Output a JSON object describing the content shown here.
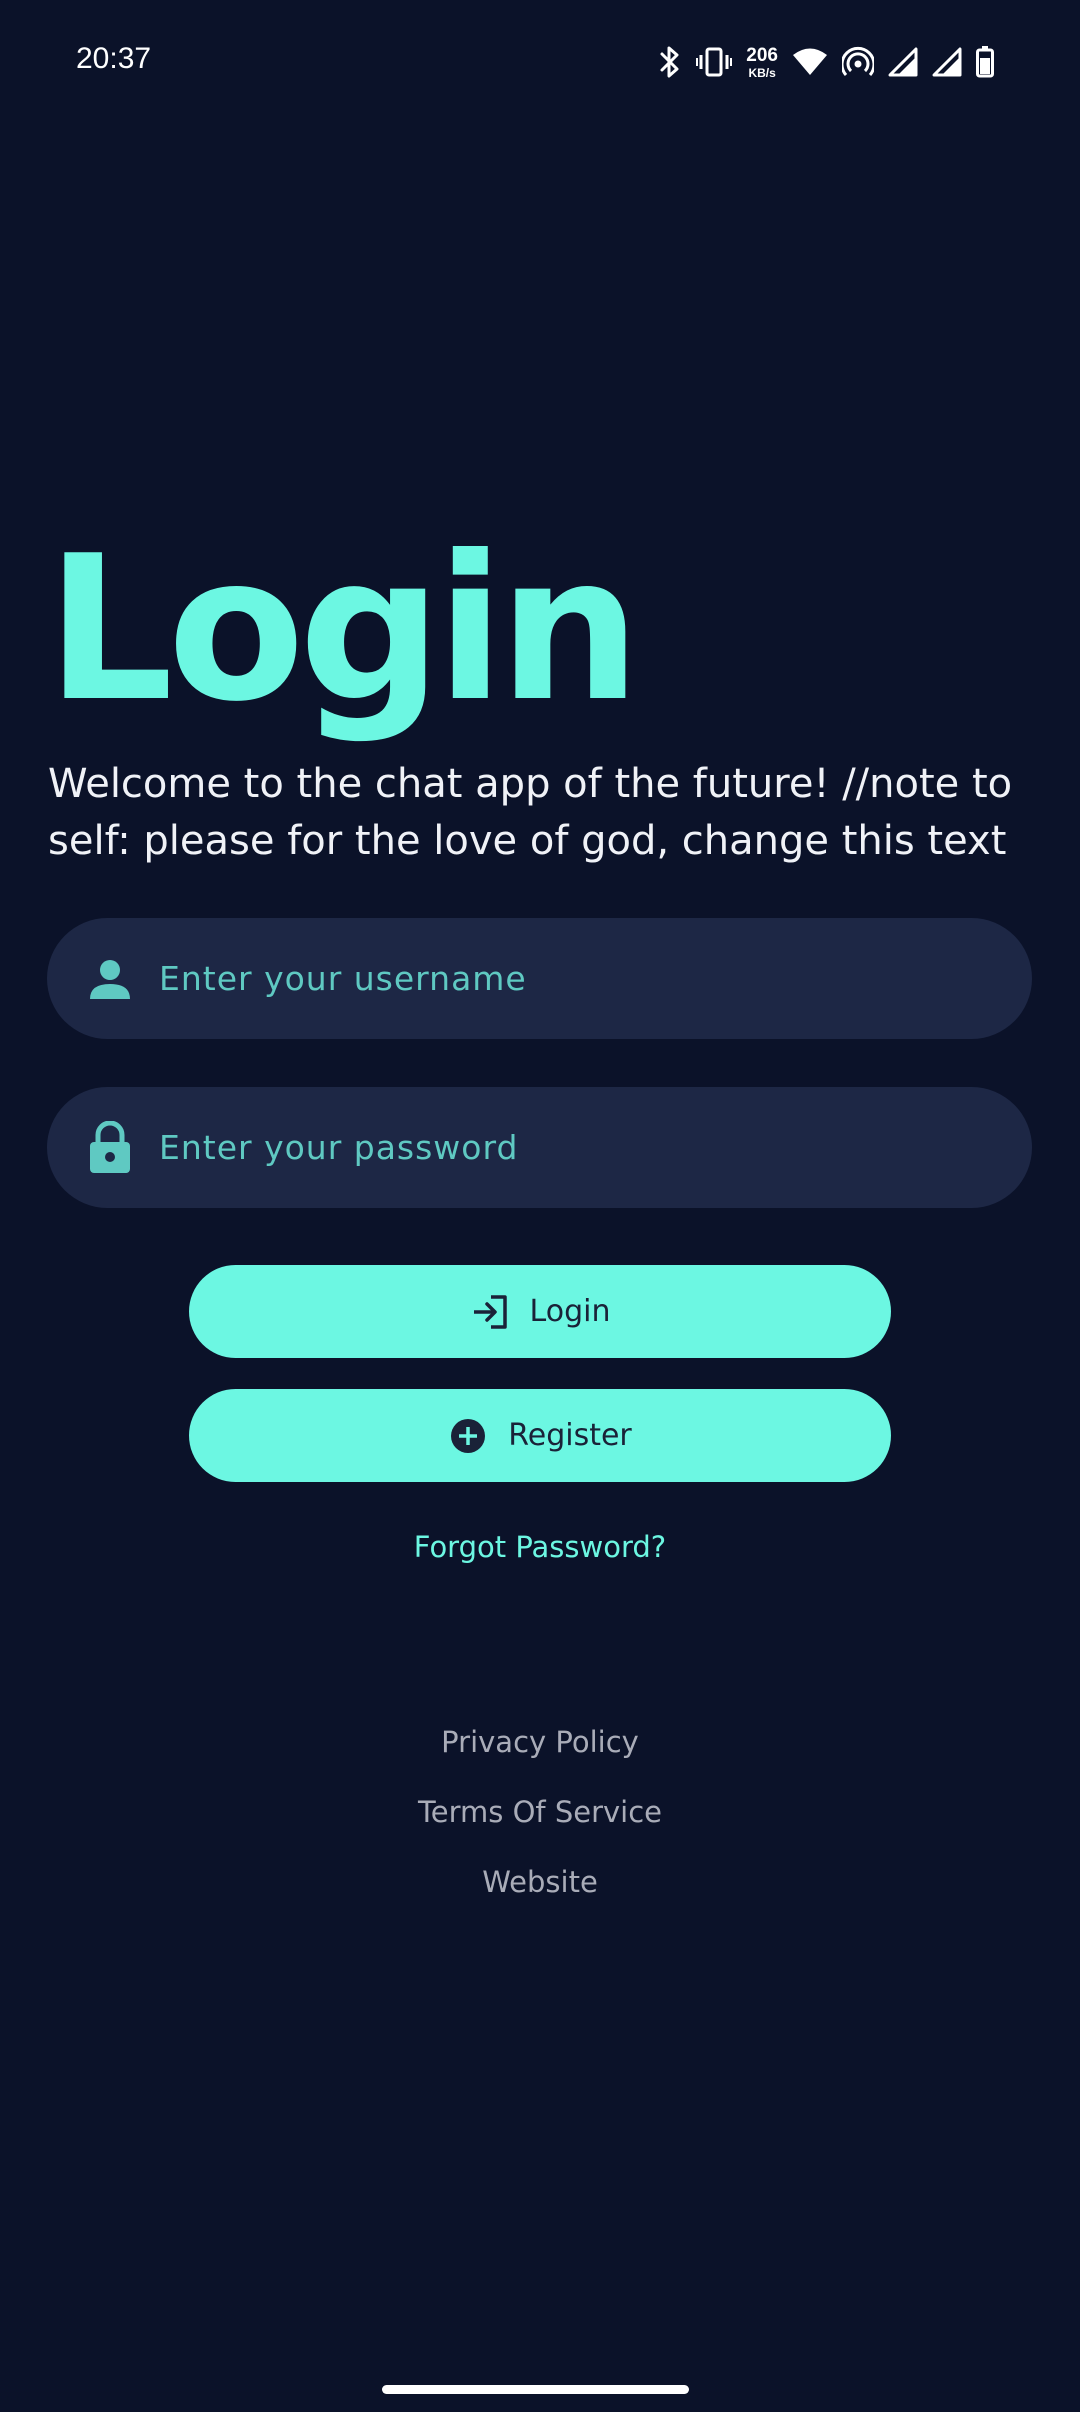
{
  "status_bar": {
    "time": "20:37",
    "net_speed_value": "206",
    "net_speed_unit": "KB/s",
    "icons": [
      "bluetooth-icon",
      "vibrate-icon",
      "wifi-icon",
      "hotspot-icon",
      "signal-icon",
      "signal-icon",
      "battery-icon"
    ]
  },
  "header": {
    "title": "Login",
    "subtitle": "Welcome to the chat app of the future! //note to self: please for the love of god, change this text"
  },
  "form": {
    "username": {
      "placeholder": "Enter your username",
      "value": "",
      "icon": "person-icon"
    },
    "password": {
      "placeholder": "Enter your password",
      "value": "",
      "icon": "lock-icon"
    }
  },
  "actions": {
    "login_label": "Login",
    "login_icon": "login-icon",
    "register_label": "Register",
    "register_icon": "add-circle-icon",
    "forgot_label": "Forgot Password?"
  },
  "footer": {
    "privacy_label": "Privacy Policy",
    "terms_label": "Terms Of Service",
    "website_label": "Website"
  },
  "colors": {
    "background": "#0b1229",
    "accent": "#6cf7e2",
    "field_background": "#1d2745",
    "placeholder": "#5fc9c2",
    "footer_text": "#a9acb8"
  }
}
